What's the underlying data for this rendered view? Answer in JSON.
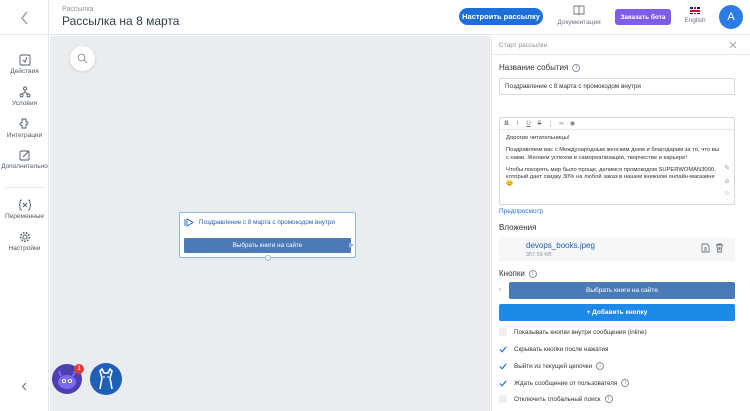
{
  "header": {
    "breadcrumb": "Рассылка",
    "title": "Рассылка на 8 марта",
    "setup_button": "Настроить рассылку",
    "docs_label": "Документация",
    "order_bot_button": "Заказать бота",
    "lang_label": "English",
    "avatar_letter": "A"
  },
  "sidebar": {
    "items": [
      {
        "label": "Действия",
        "icon": "actions-icon"
      },
      {
        "label": "Условия",
        "icon": "conditions-icon"
      },
      {
        "label": "Интеграции",
        "icon": "integrations-icon"
      },
      {
        "label": "Дополнительно",
        "icon": "additional-icon"
      },
      {
        "label": "Переменные",
        "icon": "variables-icon"
      },
      {
        "label": "Настройки",
        "icon": "settings-icon"
      }
    ],
    "collapse_icon": "chevron-left-icon"
  },
  "canvas": {
    "node": {
      "title": "Поздравление с 8 марта с промокодом внутри",
      "button_label": "Выбрать книги на сайте"
    },
    "badge_count": "1"
  },
  "panel": {
    "header": "Старт рассылки",
    "event_name_label": "Название события",
    "event_name_value": "Поздравление с 8 марта с промокодом внутри",
    "editor": {
      "p1": "Дорогие читательницы!",
      "p2": "Поздравляем вас с Международным женским днем и благодарим за то, что вы с нами. Желаем успехов в самореализации, творчестве и карьере!",
      "p3": "Чтобы покорять мир было проще, делимся промокодом SUPERWOMAN3000, который дает скидку 30% на любой заказ в нашем книжном онлайн-магазине 😊"
    },
    "preview_link": "Предпросмотр",
    "attachments_label": "Вложения",
    "attachment": {
      "name": "devops_books.jpeg",
      "size": "357.59 KB"
    },
    "buttons_label": "Кнопки",
    "button_item": "Выбрать книги на сайте",
    "add_button": "+ Добавить кнопку",
    "options": [
      {
        "label": "Показывать кнопки внутри сообщения (inline)",
        "checked": false,
        "info": false
      },
      {
        "label": "Скрывать кнопки после нажатия",
        "checked": true,
        "info": false
      },
      {
        "label": "Выйти из текущей цепочки",
        "checked": true,
        "info": true
      },
      {
        "label": "Ждать сообщение от пользователя",
        "checked": true,
        "info": true
      },
      {
        "label": "Отключить глобальный поиск",
        "checked": false,
        "info": true
      }
    ]
  },
  "colors": {
    "primary": "#1e6fd9",
    "purple": "#7e5ee8",
    "node_button": "#4a7bb7",
    "canvas_bg": "#e9ecf0"
  }
}
